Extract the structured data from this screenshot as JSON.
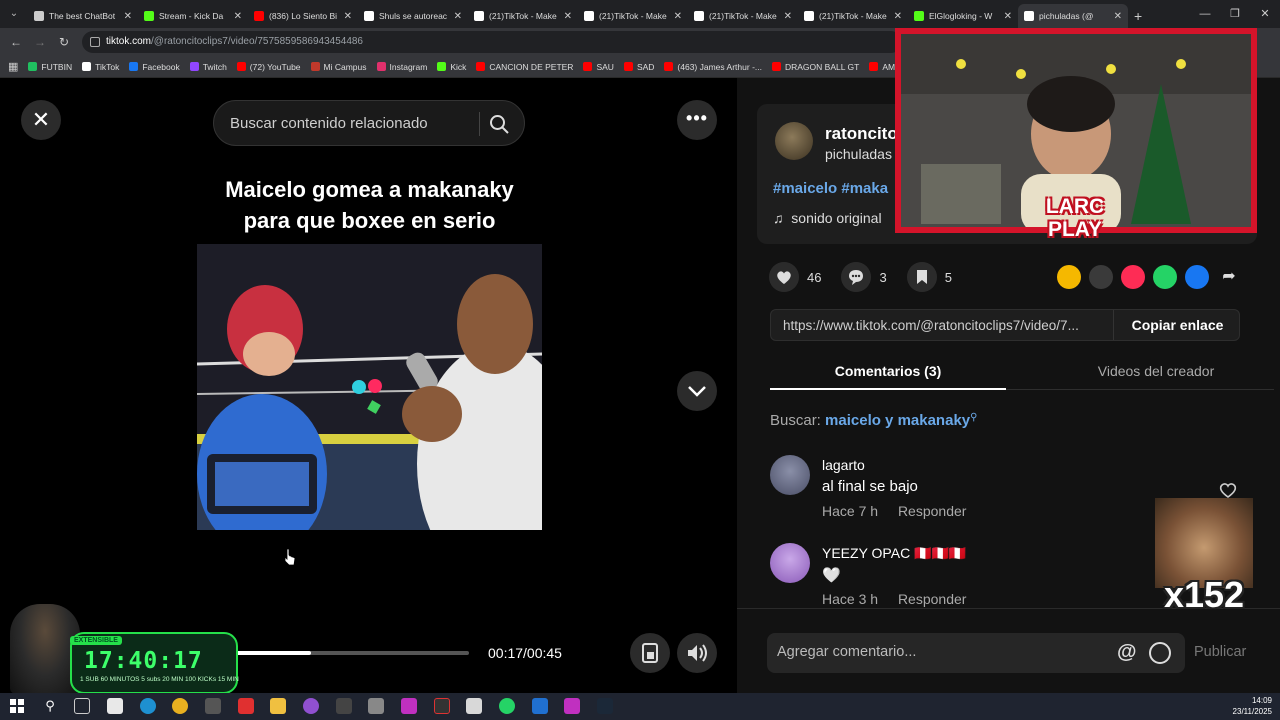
{
  "browser": {
    "tabs": [
      {
        "title": "The best ChatBot",
        "color": "#cccccc"
      },
      {
        "title": "Stream - Kick Da",
        "color": "#53fc18"
      },
      {
        "title": "(836) Lo Siento Bi",
        "color": "#ff0000"
      },
      {
        "title": "Shuls se autoreac",
        "color": "#ffffff"
      },
      {
        "title": "(21)TikTok - Make",
        "color": "#ffffff"
      },
      {
        "title": "(21)TikTok - Make",
        "color": "#ffffff"
      },
      {
        "title": "(21)TikTok - Make",
        "color": "#ffffff"
      },
      {
        "title": "(21)TikTok - Make",
        "color": "#ffffff"
      },
      {
        "title": "ElGlogloking - W",
        "color": "#53fc18"
      },
      {
        "title": "pichuladas (@",
        "color": "#ffffff"
      }
    ],
    "url_host": "tiktok.com",
    "url_path": "/@ratoncitoclips7/video/7575859586943454486",
    "bookmarks": [
      {
        "label": "FUTBIN",
        "color": "#20c060"
      },
      {
        "label": "TikTok",
        "color": "#ffffff"
      },
      {
        "label": "Facebook",
        "color": "#1877f2"
      },
      {
        "label": "Twitch",
        "color": "#9146ff"
      },
      {
        "label": "(72) YouTube",
        "color": "#ff0000"
      },
      {
        "label": "Mi Campus",
        "color": "#c0392b"
      },
      {
        "label": "Instagram",
        "color": "#e1306c"
      },
      {
        "label": "Kick",
        "color": "#53fc18"
      },
      {
        "label": "CANCION DE PETER",
        "color": "#ff0000"
      },
      {
        "label": "SAU",
        "color": "#ff0000"
      },
      {
        "label": "SAD",
        "color": "#ff0000"
      },
      {
        "label": "(463) James Arthur -...",
        "color": "#ff0000"
      },
      {
        "label": "DRAGON BALL GT",
        "color": "#ff0000"
      },
      {
        "label": "AMOR",
        "color": "#ff0000"
      }
    ]
  },
  "video": {
    "search_placeholder": "Buscar contenido relacionado",
    "title_line1": "Maicelo gomea a makanaky",
    "title_line2": "para que boxee en serio",
    "time": "00:17/00:45",
    "progress": 0.378
  },
  "post": {
    "author": "ratoncito",
    "subtitle": "pichuladas",
    "hashtags": "#maicelo #maka",
    "sound": "sonido original",
    "likes": "46",
    "comments": "3",
    "saves": "5",
    "link": "https://www.tiktok.com/@ratoncitoclips7/video/7...",
    "copy_label": "Copiar enlace"
  },
  "comments_tabs": {
    "active": "Comentarios (3)",
    "inactive": "Videos del creador"
  },
  "comments_search": {
    "prefix": "Buscar: ",
    "keyword": "maicelo y makanaky"
  },
  "comments": [
    {
      "user": "lagarto",
      "text": "al final se bajo",
      "time": "Hace 7 h",
      "reply": "Responder"
    },
    {
      "user": "YEEZY OPAC 🇵🇪🇵🇪🇵🇪",
      "text": "🤍",
      "time": "Hace 3 h",
      "reply": "Responder"
    }
  ],
  "comment_bar": {
    "placeholder": "Agregar comentario...",
    "at": "@",
    "publish": "Publicar"
  },
  "stream_overlay": {
    "brand_line1": "LARC",
    "brand_line2": "PLAY",
    "meme_count": "x152",
    "timer": "17:40:17",
    "timer_badge": "EXTENSIBLE",
    "timer_sub": "1 SUB 60 MINUTOS   5 subs 20 MIN   100 KICKs 15 MIN"
  },
  "taskbar": {
    "time": "14:09",
    "date": "23/11/2025"
  }
}
